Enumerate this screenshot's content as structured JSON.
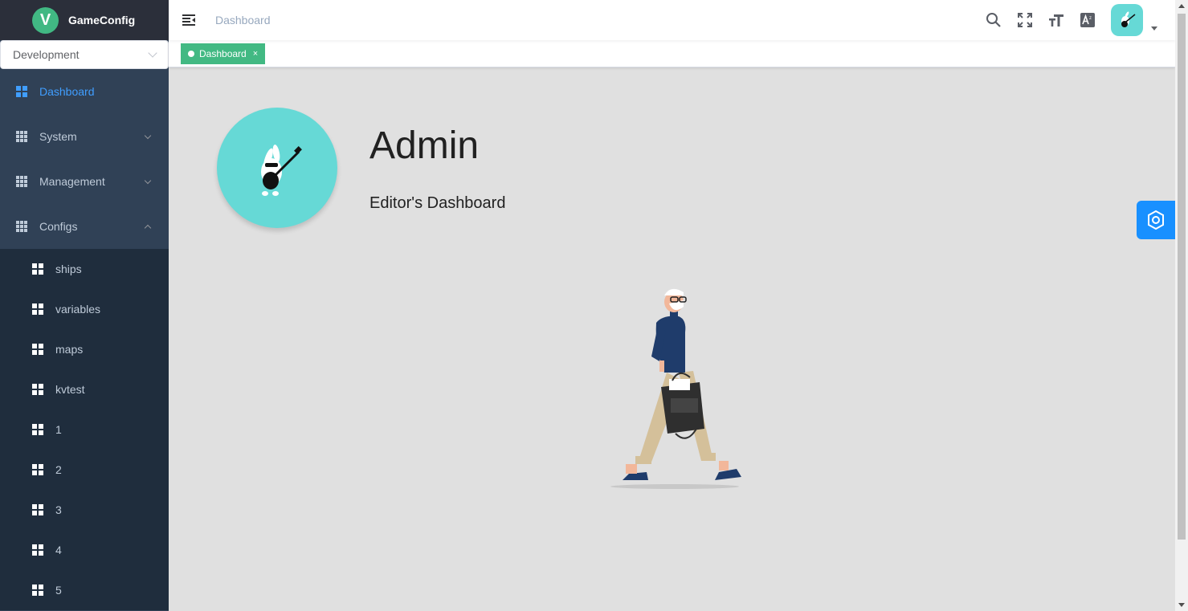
{
  "app": {
    "title": "GameConfig",
    "logo_letter": "V"
  },
  "environment": {
    "selected": "Development"
  },
  "sidebar": {
    "items": [
      {
        "label": "Dashboard",
        "icon": "dashboard-icon",
        "active": true
      },
      {
        "label": "System",
        "icon": "table-icon",
        "expandable": true,
        "expanded": false
      },
      {
        "label": "Management",
        "icon": "table-icon",
        "expandable": true,
        "expanded": false
      },
      {
        "label": "Configs",
        "icon": "table-icon",
        "expandable": true,
        "expanded": true
      }
    ],
    "config_items": [
      {
        "label": "ships"
      },
      {
        "label": "variables"
      },
      {
        "label": "maps"
      },
      {
        "label": "kvtest"
      },
      {
        "label": "1"
      },
      {
        "label": "2"
      },
      {
        "label": "3"
      },
      {
        "label": "4"
      },
      {
        "label": "5"
      }
    ]
  },
  "navbar": {
    "breadcrumb": "Dashboard",
    "icons": [
      "search-icon",
      "fullscreen-icon",
      "font-size-icon",
      "translate-icon"
    ]
  },
  "tags": [
    {
      "label": "Dashboard",
      "close": "×",
      "active": true
    }
  ],
  "profile": {
    "name": "Admin",
    "role": "Editor's Dashboard"
  },
  "colors": {
    "sidebar_bg": "#304156",
    "submenu_bg": "#1f2d3d",
    "active": "#409eff",
    "tag": "#42b983",
    "avatar": "#66d9d6",
    "settings": "#1890ff"
  }
}
